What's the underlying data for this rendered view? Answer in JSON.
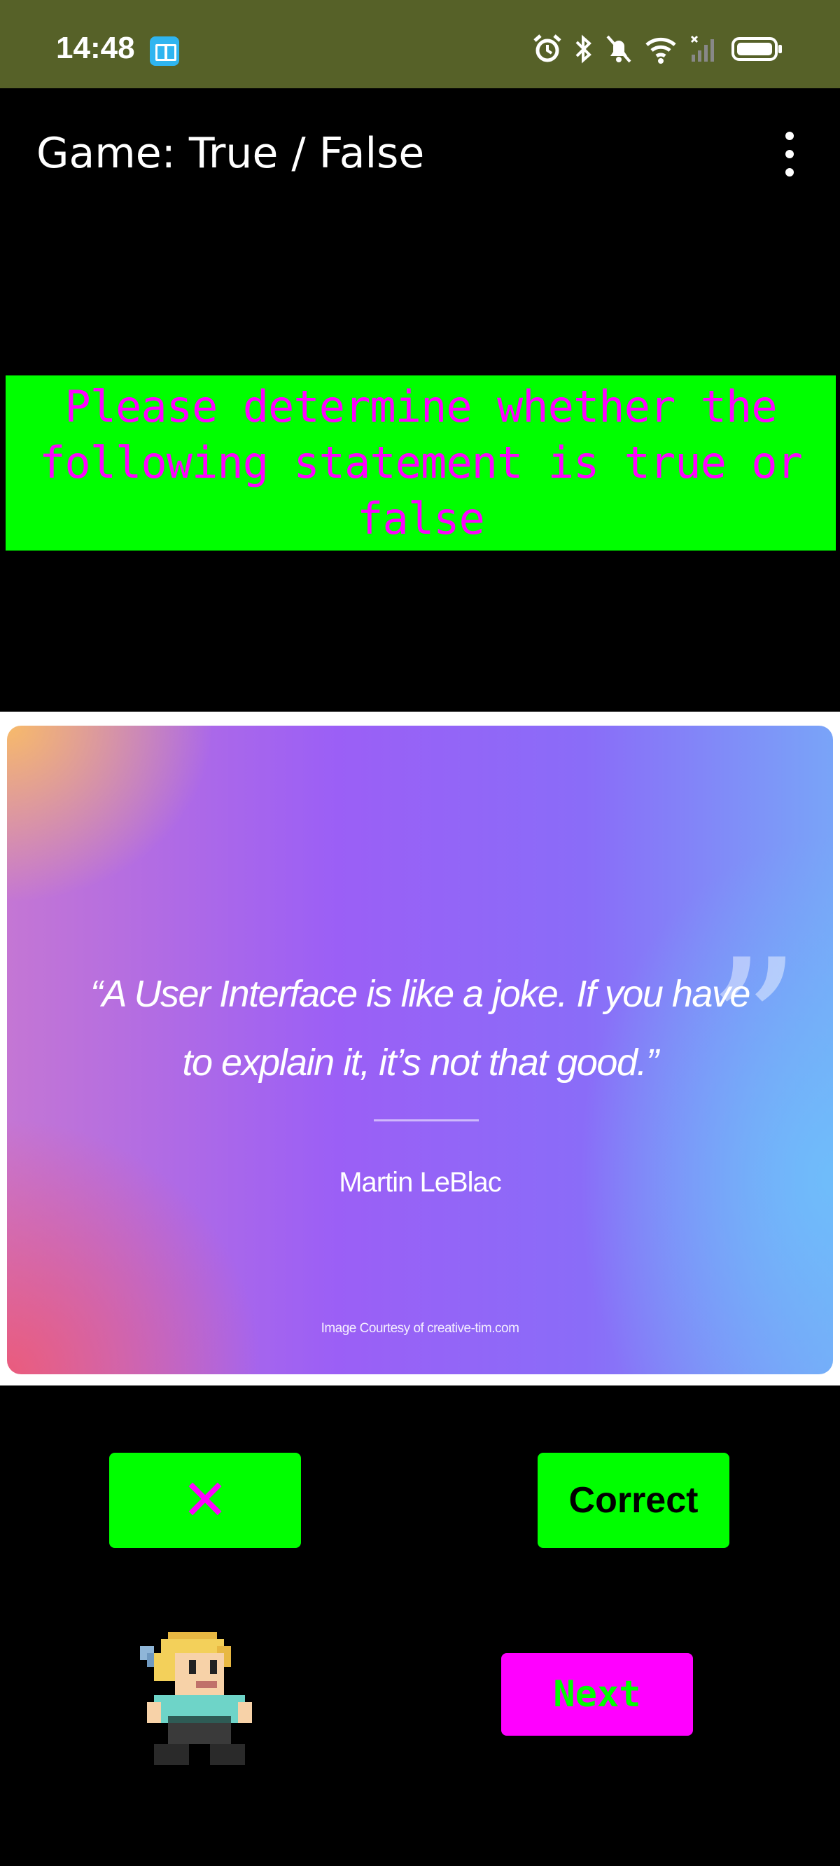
{
  "status_bar": {
    "time": "14:48",
    "app_icon": "book-icon",
    "icons": [
      "alarm-icon",
      "bluetooth-icon",
      "mute-icon",
      "wifi-icon",
      "signal-icon",
      "battery-icon"
    ]
  },
  "app_bar": {
    "title": "Game: True / False",
    "menu_icon": "more-vert-icon"
  },
  "prompt": {
    "line1": "Please determine whether the",
    "line2": "following statement is true or false"
  },
  "quote_card": {
    "quote_line1": "“A User Interface is like a joke. If you have",
    "quote_line2": "to explain it, it’s not that good.”",
    "quote_mark": "”",
    "author": "Martin LeBlac",
    "credit": "Image Courtesy of creative-tim.com"
  },
  "buttons": {
    "wrong_label": "✕",
    "correct_label": "Correct",
    "next_label": "Next"
  },
  "colors": {
    "status_bar": "#566128",
    "accent_green": "#00ff00",
    "accent_magenta": "#ff00ff"
  }
}
